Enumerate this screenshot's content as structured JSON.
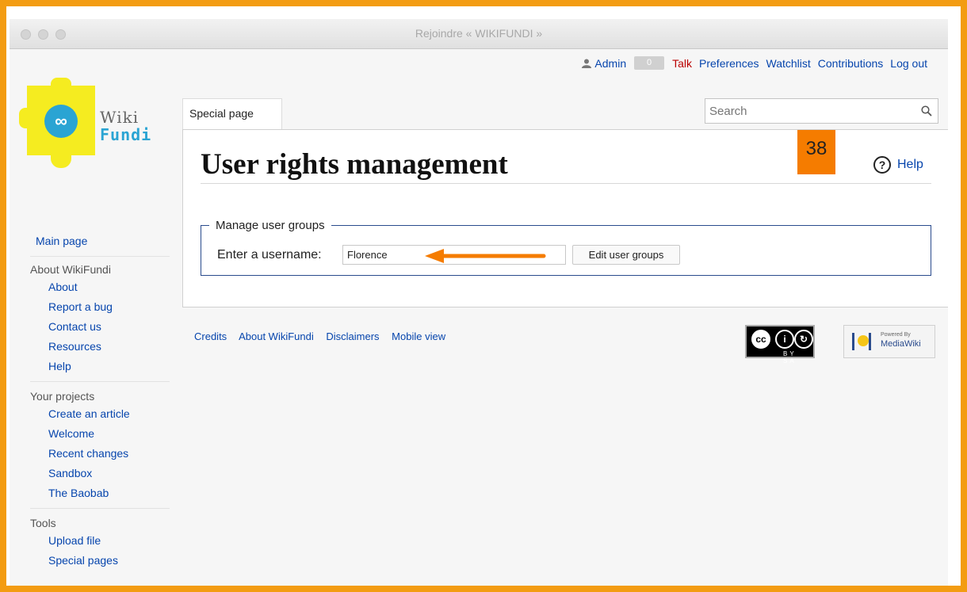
{
  "window": {
    "title": "Rejoindre « WIKIFUNDI »"
  },
  "personal_tools": {
    "user": "Admin",
    "notification_count": "0",
    "talk": "Talk",
    "preferences": "Preferences",
    "watchlist": "Watchlist",
    "contributions": "Contributions",
    "logout": "Log out"
  },
  "logo": {
    "word1": "Wiki",
    "word2": "Fundi"
  },
  "tabs": {
    "special_page": "Special page"
  },
  "search": {
    "placeholder": "Search"
  },
  "page": {
    "title": "User rights management",
    "indicator_number": "38",
    "help": "Help"
  },
  "form": {
    "legend": "Manage user groups",
    "label": "Enter a username:",
    "username_value": "Florence",
    "submit": "Edit user groups"
  },
  "sidebar": {
    "main_page": "Main page",
    "about_heading": "About WikiFundi",
    "about_items": [
      "About",
      "Report a bug",
      "Contact us",
      "Resources",
      "Help"
    ],
    "projects_heading": "Your projects",
    "projects_items": [
      "Create an article",
      "Welcome",
      "Recent changes",
      "Sandbox",
      "The Baobab"
    ],
    "tools_heading": "Tools",
    "tools_items": [
      "Upload file",
      "Special pages"
    ]
  },
  "footer": {
    "links": [
      "Credits",
      "About WikiFundi",
      "Disclaimers",
      "Mobile view"
    ],
    "cc_label": "BY  SA",
    "mw_powered": "Powered By",
    "mw_name": "MediaWiki"
  },
  "colors": {
    "accent_orange": "#f39c12",
    "link_blue": "#0645ad",
    "indicator": "#f57c00",
    "logo_yellow": "#f5ec20",
    "logo_blue": "#2aa4d3"
  },
  "icons": {
    "user": "user-icon",
    "search": "search-icon",
    "help": "help-icon",
    "arrow": "arrow-icon"
  }
}
